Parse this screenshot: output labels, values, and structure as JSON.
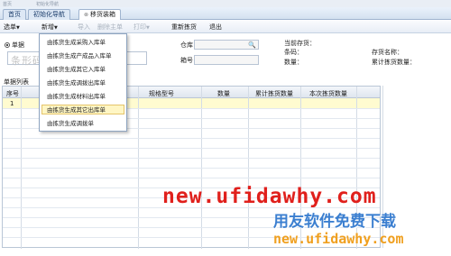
{
  "top_strip": [
    "首页",
    "初始化导航"
  ],
  "tabs": [
    {
      "label": "首页",
      "active": false
    },
    {
      "label": "初始化导航",
      "active": false
    },
    {
      "label": "移货装箱",
      "active": true
    }
  ],
  "toolbar": {
    "select": "选单",
    "add": "新增",
    "import": "导入",
    "delete_header": "删除主单",
    "print": "打印",
    "rescan": "重新拣货",
    "exit": "退出"
  },
  "form": {
    "radio_label": "单据",
    "barcode_placeholder": "条形码",
    "warehouse_label": "仓库",
    "box_label": "箱号",
    "current_label": "当前存货：",
    "barcode_label": "条码：",
    "qty_label": "数量：",
    "inv_name_label": "存货名称：",
    "total_label": "累计拣货数量："
  },
  "list": {
    "title": "单据列表",
    "columns": [
      "序号",
      "规格型号",
      "数量",
      "累计拣货数量",
      "本次拣货数量"
    ],
    "rows": [
      {
        "seq": "1"
      }
    ]
  },
  "menu": {
    "items": [
      "由拣货生成采购入库单",
      "由拣货生成产成品入库单",
      "由拣货生成其它入库单",
      "由拣货生成调拨出库单",
      "由拣货生成材料出库单",
      "由拣货生成其它出库单",
      "由拣货生成调拨单"
    ],
    "hover_index": 5
  },
  "watermark": {
    "url": "new.ufidawhy.com",
    "title": "用友软件免费下载",
    "url2": "new.ufidawhy.com"
  },
  "colors": {
    "watermark_red": "#e0201c",
    "watermark_blue": "#3b7fd0",
    "watermark_orange": "#f0a020",
    "menu_hover": "#fff6c4",
    "row_highlight": "#fffbd0"
  }
}
